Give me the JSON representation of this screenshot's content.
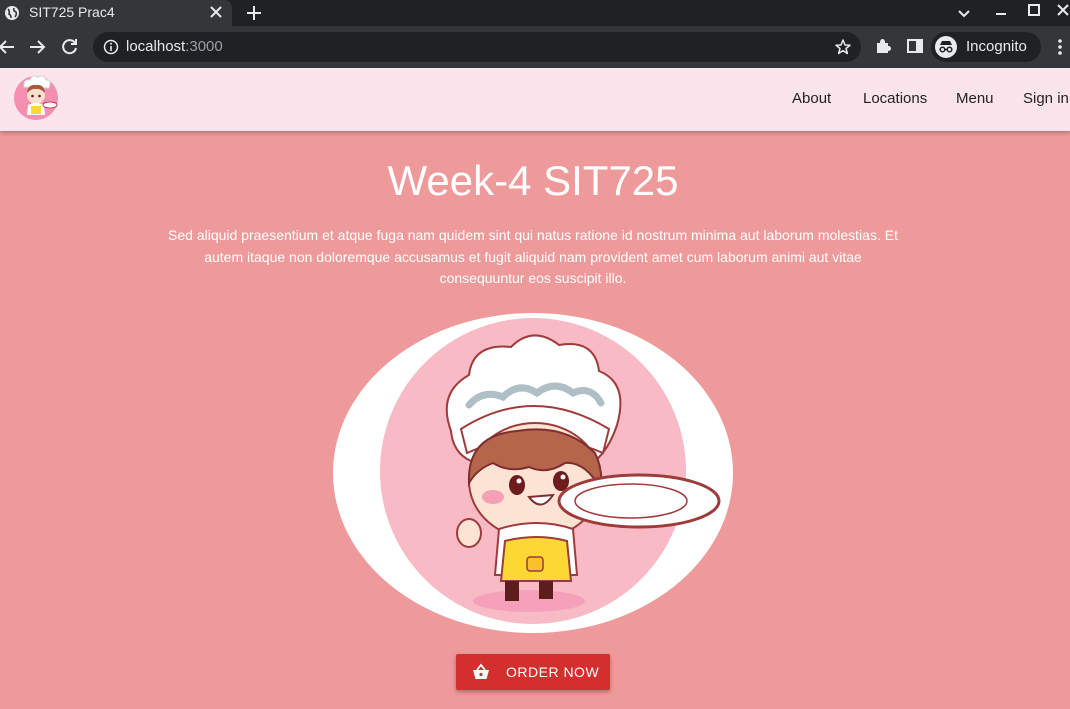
{
  "browser": {
    "tab_title": "SIT725 Prac4",
    "url_host": "localhost",
    "url_port": ":3000",
    "profile_label": "Incognito"
  },
  "site": {
    "nav_links": [
      "About",
      "Locations",
      "Menu",
      "Sign in"
    ]
  },
  "hero": {
    "title": "Week-4 SIT725",
    "text": "Sed aliquid praesentium et atque fuga nam quidem sint qui natus ratione id nostrum minima aut laborum molestias. Et autem itaque non doloremque accusamus et fugit aliquid nam provident amet cum laborum animi aut vitae consequuntur eos suscipit illo.",
    "button_label": "ORDER NOW"
  },
  "colors": {
    "page_bg": "#ee9a9a",
    "nav_bg": "#fce4ec",
    "button_bg": "#d32f2f"
  },
  "icons": [
    "globe-icon",
    "close-icon",
    "plus-icon",
    "back-icon",
    "forward-icon",
    "reload-icon",
    "info-icon",
    "star-icon",
    "puzzle-icon",
    "side-panel-icon",
    "incognito-icon",
    "more-icon",
    "basket-icon",
    "chef-logo"
  ]
}
